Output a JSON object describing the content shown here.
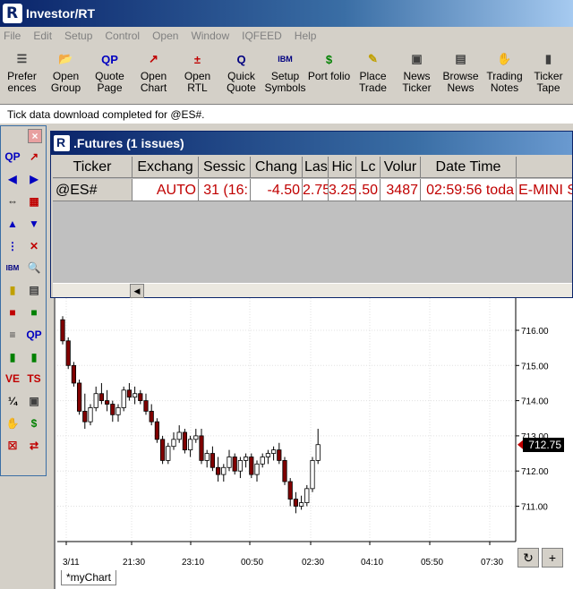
{
  "app": {
    "title": "Investor/RT"
  },
  "menu": [
    "File",
    "Edit",
    "Setup",
    "Control",
    "Open",
    "Window",
    "IQFEED",
    "Help"
  ],
  "toolbar": [
    {
      "label": "Prefer ences",
      "icon": "preferences-icon"
    },
    {
      "label": "Open Group",
      "icon": "open-folder-icon"
    },
    {
      "label": "Quote Page",
      "icon": "qp-icon"
    },
    {
      "label": "Open Chart",
      "icon": "line-chart-icon"
    },
    {
      "label": "Open RTL",
      "icon": "rtl-icon"
    },
    {
      "label": "Quick Quote",
      "icon": "quick-quote-icon"
    },
    {
      "label": "Setup Symbols",
      "icon": "ibm-symbols-icon"
    },
    {
      "label": "Port folio",
      "icon": "money-bag-icon"
    },
    {
      "label": "Place Trade",
      "icon": "trade-pencil-icon"
    },
    {
      "label": "News Ticker",
      "icon": "tv-icon"
    },
    {
      "label": "Browse News",
      "icon": "newspaper-icon"
    },
    {
      "label": "Trading Notes",
      "icon": "notes-icon"
    },
    {
      "label": "Ticker Tape",
      "icon": "ticker-tape-icon"
    }
  ],
  "status": {
    "message": "Tick data download completed for @ES#."
  },
  "palette": {
    "icons": [
      {
        "name": "qp-icon",
        "glyph": "QP"
      },
      {
        "name": "line-chart-icon",
        "glyph": "↗"
      },
      {
        "name": "arrow-left-icon",
        "glyph": "◀"
      },
      {
        "name": "arrow-right-icon",
        "glyph": "▶"
      },
      {
        "name": "expand-horizontal-icon",
        "glyph": "⇔"
      },
      {
        "name": "chart-window-icon",
        "glyph": "▦"
      },
      {
        "name": "arrow-up-icon",
        "glyph": "▲"
      },
      {
        "name": "arrow-down-icon",
        "glyph": "▼"
      },
      {
        "name": "tree-icon",
        "glyph": "⋮"
      },
      {
        "name": "xyz-icon",
        "glyph": "✕"
      },
      {
        "name": "ibm-icon",
        "glyph": "IBM"
      },
      {
        "name": "magnify-icon",
        "glyph": "🔍"
      },
      {
        "name": "lock-icon",
        "glyph": "▮"
      },
      {
        "name": "calculator-icon",
        "glyph": "▤"
      },
      {
        "name": "trash-red-icon",
        "glyph": "■"
      },
      {
        "name": "trash-green-icon",
        "glyph": "■"
      },
      {
        "name": "database-icon",
        "glyph": "≡"
      },
      {
        "name": "qp-small-icon",
        "glyph": "QP"
      },
      {
        "name": "bar-chart-icon",
        "glyph": "▮"
      },
      {
        "name": "bar-chart-2-icon",
        "glyph": "▮"
      },
      {
        "name": "ve-icon",
        "glyph": "VE"
      },
      {
        "name": "ts-icon",
        "glyph": "TS"
      },
      {
        "name": "ratio-icon",
        "glyph": "¼"
      },
      {
        "name": "monitor-icon",
        "glyph": "▣"
      },
      {
        "name": "hand-icon",
        "glyph": "✋"
      },
      {
        "name": "money-icon",
        "glyph": "$"
      },
      {
        "name": "close-box-icon",
        "glyph": "☒"
      },
      {
        "name": "swap-icon",
        "glyph": "⇄"
      }
    ],
    "close_glyph": "×"
  },
  "futures": {
    "title": ".Futures (1 issues)",
    "columns": [
      {
        "label": "Ticker",
        "w": 89
      },
      {
        "label": "Exchang",
        "w": 74
      },
      {
        "label": "Sessic",
        "w": 58
      },
      {
        "label": "Chang",
        "w": 58
      },
      {
        "label": "Las",
        "w": 29
      },
      {
        "label": "Hic",
        "w": 31
      },
      {
        "label": "Lc",
        "w": 27
      },
      {
        "label": "Volur",
        "w": 45
      },
      {
        "label": "Date Time",
        "w": 107
      },
      {
        "label": "",
        "w": 70
      }
    ],
    "row": [
      "@ES#",
      "AUTO",
      "31 (16:",
      "-4.50",
      "2.75",
      "3.25",
      ".50",
      "3487",
      "02:59:56 toda",
      "E-MINI S"
    ]
  },
  "chart": {
    "tab_label": "*myChart",
    "last_price_label": "712.75",
    "y_ticks": [
      "716.00",
      "715.00",
      "714.00",
      "713.00",
      "712.00",
      "711.00"
    ],
    "x_ticks": [
      "3/11",
      "21:30",
      "23:10",
      "00:50",
      "02:30",
      "04:10",
      "05:50",
      "07:30"
    ],
    "refresh_glyph": "↻",
    "add_glyph": "+"
  },
  "chart_data": {
    "type": "candlestick",
    "symbol": "@ES#",
    "x_ticks": [
      "3/11",
      "21:30",
      "23:10",
      "00:50",
      "02:30",
      "04:10",
      "05:50",
      "07:30"
    ],
    "y_range": [
      710.5,
      716.4
    ],
    "last": 712.75,
    "bars": [
      [
        716.3,
        716.4,
        715.6,
        715.7
      ],
      [
        715.7,
        715.8,
        714.9,
        715.0
      ],
      [
        715.0,
        715.1,
        714.4,
        714.5
      ],
      [
        714.5,
        714.6,
        713.6,
        713.7
      ],
      [
        713.7,
        714.2,
        713.2,
        713.4
      ],
      [
        713.4,
        713.9,
        713.3,
        713.8
      ],
      [
        713.8,
        714.4,
        713.7,
        714.2
      ],
      [
        714.2,
        714.5,
        713.9,
        714.0
      ],
      [
        714.0,
        714.3,
        713.7,
        713.9
      ],
      [
        713.9,
        714.0,
        713.4,
        713.6
      ],
      [
        713.6,
        713.9,
        713.4,
        713.8
      ],
      [
        713.8,
        714.4,
        713.7,
        714.3
      ],
      [
        714.3,
        714.5,
        714.0,
        714.1
      ],
      [
        714.1,
        714.4,
        713.9,
        714.2
      ],
      [
        714.2,
        714.3,
        713.9,
        714.0
      ],
      [
        714.0,
        714.2,
        713.6,
        713.7
      ],
      [
        713.7,
        713.9,
        713.3,
        713.4
      ],
      [
        713.4,
        713.5,
        712.8,
        712.9
      ],
      [
        712.9,
        713.0,
        712.2,
        712.3
      ],
      [
        712.3,
        712.8,
        712.2,
        712.7
      ],
      [
        712.7,
        713.1,
        712.6,
        712.9
      ],
      [
        712.9,
        713.3,
        712.8,
        713.1
      ],
      [
        713.1,
        713.2,
        712.5,
        712.6
      ],
      [
        712.6,
        713.0,
        712.4,
        712.9
      ],
      [
        712.9,
        713.2,
        712.8,
        713.0
      ],
      [
        713.0,
        713.2,
        712.2,
        712.3
      ],
      [
        712.3,
        712.6,
        712.1,
        712.5
      ],
      [
        712.5,
        712.7,
        712.0,
        712.1
      ],
      [
        712.1,
        712.4,
        711.7,
        711.9
      ],
      [
        711.9,
        712.2,
        711.7,
        712.1
      ],
      [
        712.1,
        712.6,
        712.0,
        712.4
      ],
      [
        712.4,
        712.5,
        711.9,
        712.0
      ],
      [
        712.0,
        712.4,
        711.8,
        712.3
      ],
      [
        712.3,
        712.5,
        712.1,
        712.4
      ],
      [
        712.4,
        712.5,
        711.8,
        711.9
      ],
      [
        711.9,
        712.3,
        711.7,
        712.2
      ],
      [
        712.2,
        712.5,
        712.1,
        712.4
      ],
      [
        712.4,
        712.6,
        712.2,
        712.5
      ],
      [
        712.5,
        712.7,
        712.3,
        712.6
      ],
      [
        712.6,
        712.8,
        712.2,
        712.3
      ],
      [
        712.3,
        712.4,
        711.6,
        711.7
      ],
      [
        711.7,
        711.8,
        711.0,
        711.2
      ],
      [
        711.2,
        711.4,
        710.8,
        711.0
      ],
      [
        711.0,
        711.3,
        710.9,
        711.1
      ],
      [
        711.1,
        711.6,
        711.0,
        711.5
      ],
      [
        711.5,
        712.4,
        711.4,
        712.3
      ],
      [
        712.3,
        713.2,
        712.2,
        712.75
      ]
    ]
  }
}
